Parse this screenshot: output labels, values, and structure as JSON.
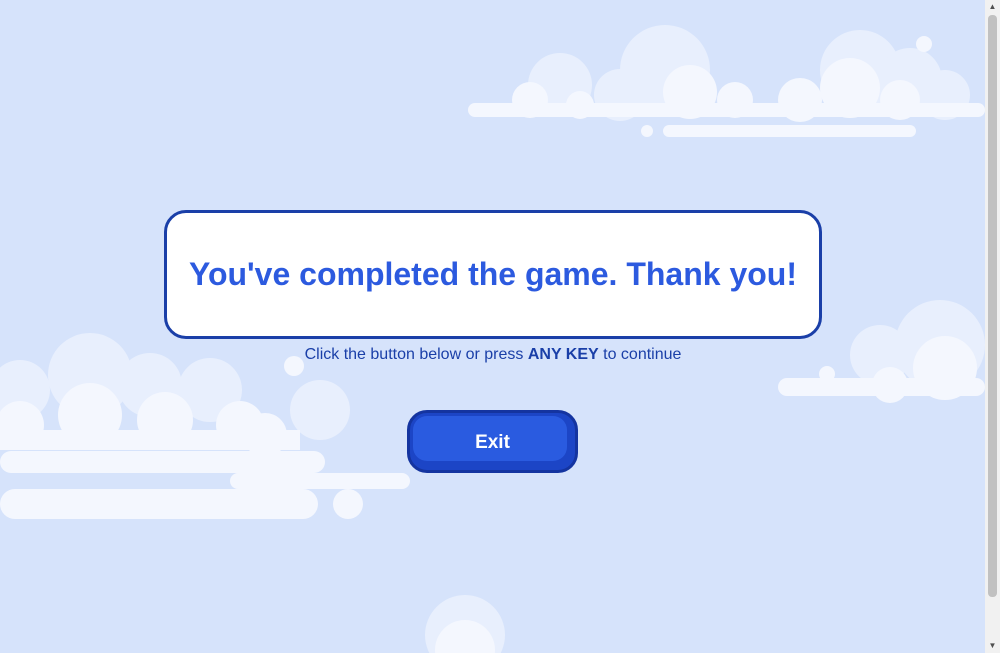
{
  "colors": {
    "background": "#d6e3fb",
    "cloud": "#f4f7fe",
    "title_text": "#2c5adf",
    "border": "#1a3fa8",
    "button": "#2a5be0"
  },
  "message": {
    "title": "You've completed the game. Thank you!"
  },
  "hint": {
    "prefix": "Click the button below or press",
    "key": "ANY KEY",
    "suffix": "to continue"
  },
  "exit_button": {
    "label": "Exit"
  },
  "scrollbar": {
    "up_icon": "triangle-up",
    "down_icon": "triangle-down"
  }
}
